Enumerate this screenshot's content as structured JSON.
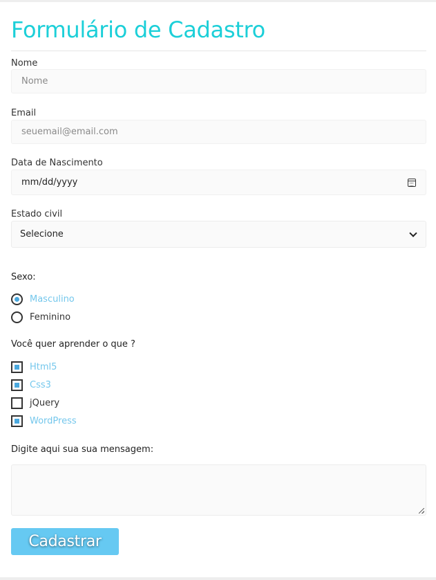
{
  "form": {
    "title": "Formulário de Cadastro",
    "nome": {
      "label": "Nome",
      "placeholder": "Nome"
    },
    "email": {
      "label": "Email",
      "placeholder": "seuemail@email.com"
    },
    "nascimento": {
      "label": "Data de Nascimento",
      "value": "mm/dd/yyyy",
      "icon": "calendar-icon"
    },
    "estado_civil": {
      "label": "Estado civil",
      "selected": "Selecione",
      "icon": "chevron-down-icon"
    },
    "sexo": {
      "label": "Sexo:",
      "options": [
        {
          "label": "Masculino",
          "checked": true
        },
        {
          "label": "Feminino",
          "checked": false
        }
      ]
    },
    "aprender": {
      "label": "Você quer aprender o que ?",
      "options": [
        {
          "label": "Html5",
          "checked": true
        },
        {
          "label": "Css3",
          "checked": true
        },
        {
          "label": "jQuery",
          "checked": false
        },
        {
          "label": "WordPress",
          "checked": true
        }
      ]
    },
    "mensagem": {
      "label": "Digite aqui sua sua mensagem:"
    },
    "submit_label": "Cadastrar"
  },
  "colors": {
    "title": "#1ccfd8",
    "button": "#66c9f2",
    "checked_text": "#74c7ec",
    "checked_mark": "#4aa8de"
  }
}
